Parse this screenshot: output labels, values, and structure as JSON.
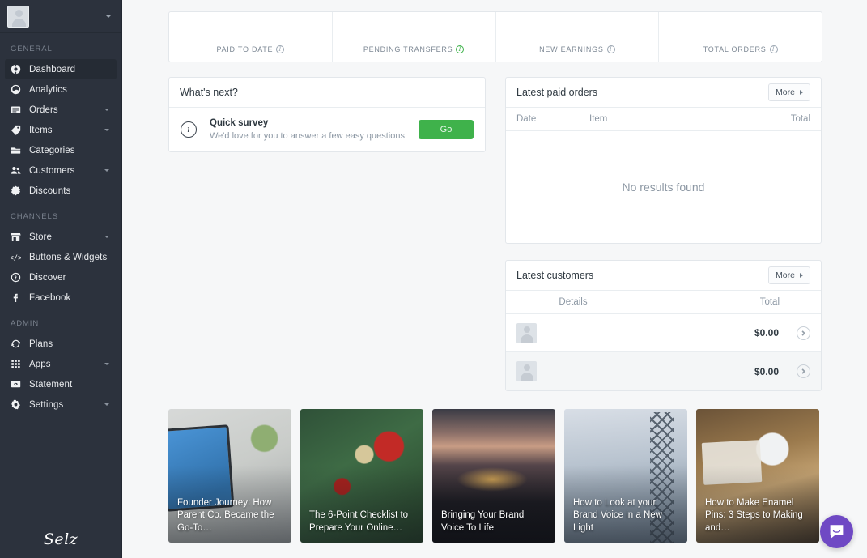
{
  "sidebar": {
    "profile": {
      "avatar_alt": "user-avatar-placeholder",
      "caret": "chevron-down-icon"
    },
    "sections": [
      {
        "title": "GENERAL",
        "items": [
          {
            "label": "Dashboard",
            "icon": "dashboard-icon",
            "active": true,
            "caret": false
          },
          {
            "label": "Analytics",
            "icon": "analytics-icon",
            "active": false,
            "caret": false
          },
          {
            "label": "Orders",
            "icon": "orders-icon",
            "active": false,
            "caret": true
          },
          {
            "label": "Items",
            "icon": "tag-icon",
            "active": false,
            "caret": true
          },
          {
            "label": "Categories",
            "icon": "folder-icon",
            "active": false,
            "caret": false
          },
          {
            "label": "Customers",
            "icon": "people-icon",
            "active": false,
            "caret": true
          },
          {
            "label": "Discounts",
            "icon": "discount-icon",
            "active": false,
            "caret": false
          }
        ]
      },
      {
        "title": "CHANNELS",
        "items": [
          {
            "label": "Store",
            "icon": "store-icon",
            "active": false,
            "caret": true
          },
          {
            "label": "Buttons & Widgets",
            "icon": "code-icon",
            "active": false,
            "caret": false
          },
          {
            "label": "Discover",
            "icon": "discover-icon",
            "active": false,
            "caret": false
          },
          {
            "label": "Facebook",
            "icon": "facebook-icon",
            "active": false,
            "caret": false
          }
        ]
      },
      {
        "title": "ADMIN",
        "items": [
          {
            "label": "Plans",
            "icon": "refresh-icon",
            "active": false,
            "caret": false
          },
          {
            "label": "Apps",
            "icon": "grid-icon",
            "active": false,
            "caret": true
          },
          {
            "label": "Statement",
            "icon": "statement-icon",
            "active": false,
            "caret": false
          },
          {
            "label": "Settings",
            "icon": "gear-icon",
            "active": false,
            "caret": true
          }
        ]
      }
    ],
    "logo": "Selz"
  },
  "stats": [
    {
      "label": "PAID TO DATE",
      "value": "",
      "info_icon": "info-icon",
      "info_green": false
    },
    {
      "label": "PENDING TRANSFERS",
      "value": "",
      "info_icon": "info-icon-green",
      "info_green": true
    },
    {
      "label": "NEW EARNINGS",
      "value": "",
      "info_icon": "info-icon",
      "info_green": false
    },
    {
      "label": "TOTAL ORDERS",
      "value": "",
      "info_icon": "info-icon",
      "info_green": false
    }
  ],
  "whats_next": {
    "title": "What's next?",
    "item": {
      "icon": "info-circle-icon",
      "title": "Quick survey",
      "subtitle": "We'd love for you to answer a few easy questions",
      "button_label": "Go"
    }
  },
  "latest_paid_orders": {
    "title": "Latest paid orders",
    "more_label": "More",
    "columns": [
      "Date",
      "Item",
      "Total"
    ],
    "empty_text": "No results found",
    "rows": []
  },
  "latest_customers": {
    "title": "Latest customers",
    "more_label": "More",
    "columns": [
      "Details",
      "Total"
    ],
    "rows": [
      {
        "avatar": "customer-avatar-placeholder",
        "details": "",
        "total": "$0.00",
        "chevron": "chevron-right-icon"
      },
      {
        "avatar": "customer-avatar-placeholder",
        "details": "",
        "total": "$0.00",
        "chevron": "chevron-right-icon"
      }
    ]
  },
  "blog_cards": [
    {
      "title": "Founder Journey: How Parent Co. Became the Go-To…",
      "photo": "ph1"
    },
    {
      "title": "The 6-Point Checklist to Prepare Your Online…",
      "photo": "ph2"
    },
    {
      "title": "Bringing Your Brand Voice To Life",
      "photo": "ph3"
    },
    {
      "title": "How to Look at your Brand Voice in a New Light",
      "photo": "ph4"
    },
    {
      "title": "How to Make Enamel Pins: 3 Steps to Making and…",
      "photo": "ph5"
    }
  ],
  "chat_widget": {
    "icon": "chat-bubble-icon",
    "color": "#6f49c4"
  },
  "colors": {
    "sidebar_bg": "#2c323d",
    "sidebar_active": "#252b34",
    "page_bg": "#f6f7f8",
    "card_bg": "#ffffff",
    "border": "#e3e7eb",
    "accent_green": "#3fb24b",
    "text_dark": "#2f3941",
    "text_muted": "#8d98a4",
    "chat_purple": "#6f49c4"
  }
}
